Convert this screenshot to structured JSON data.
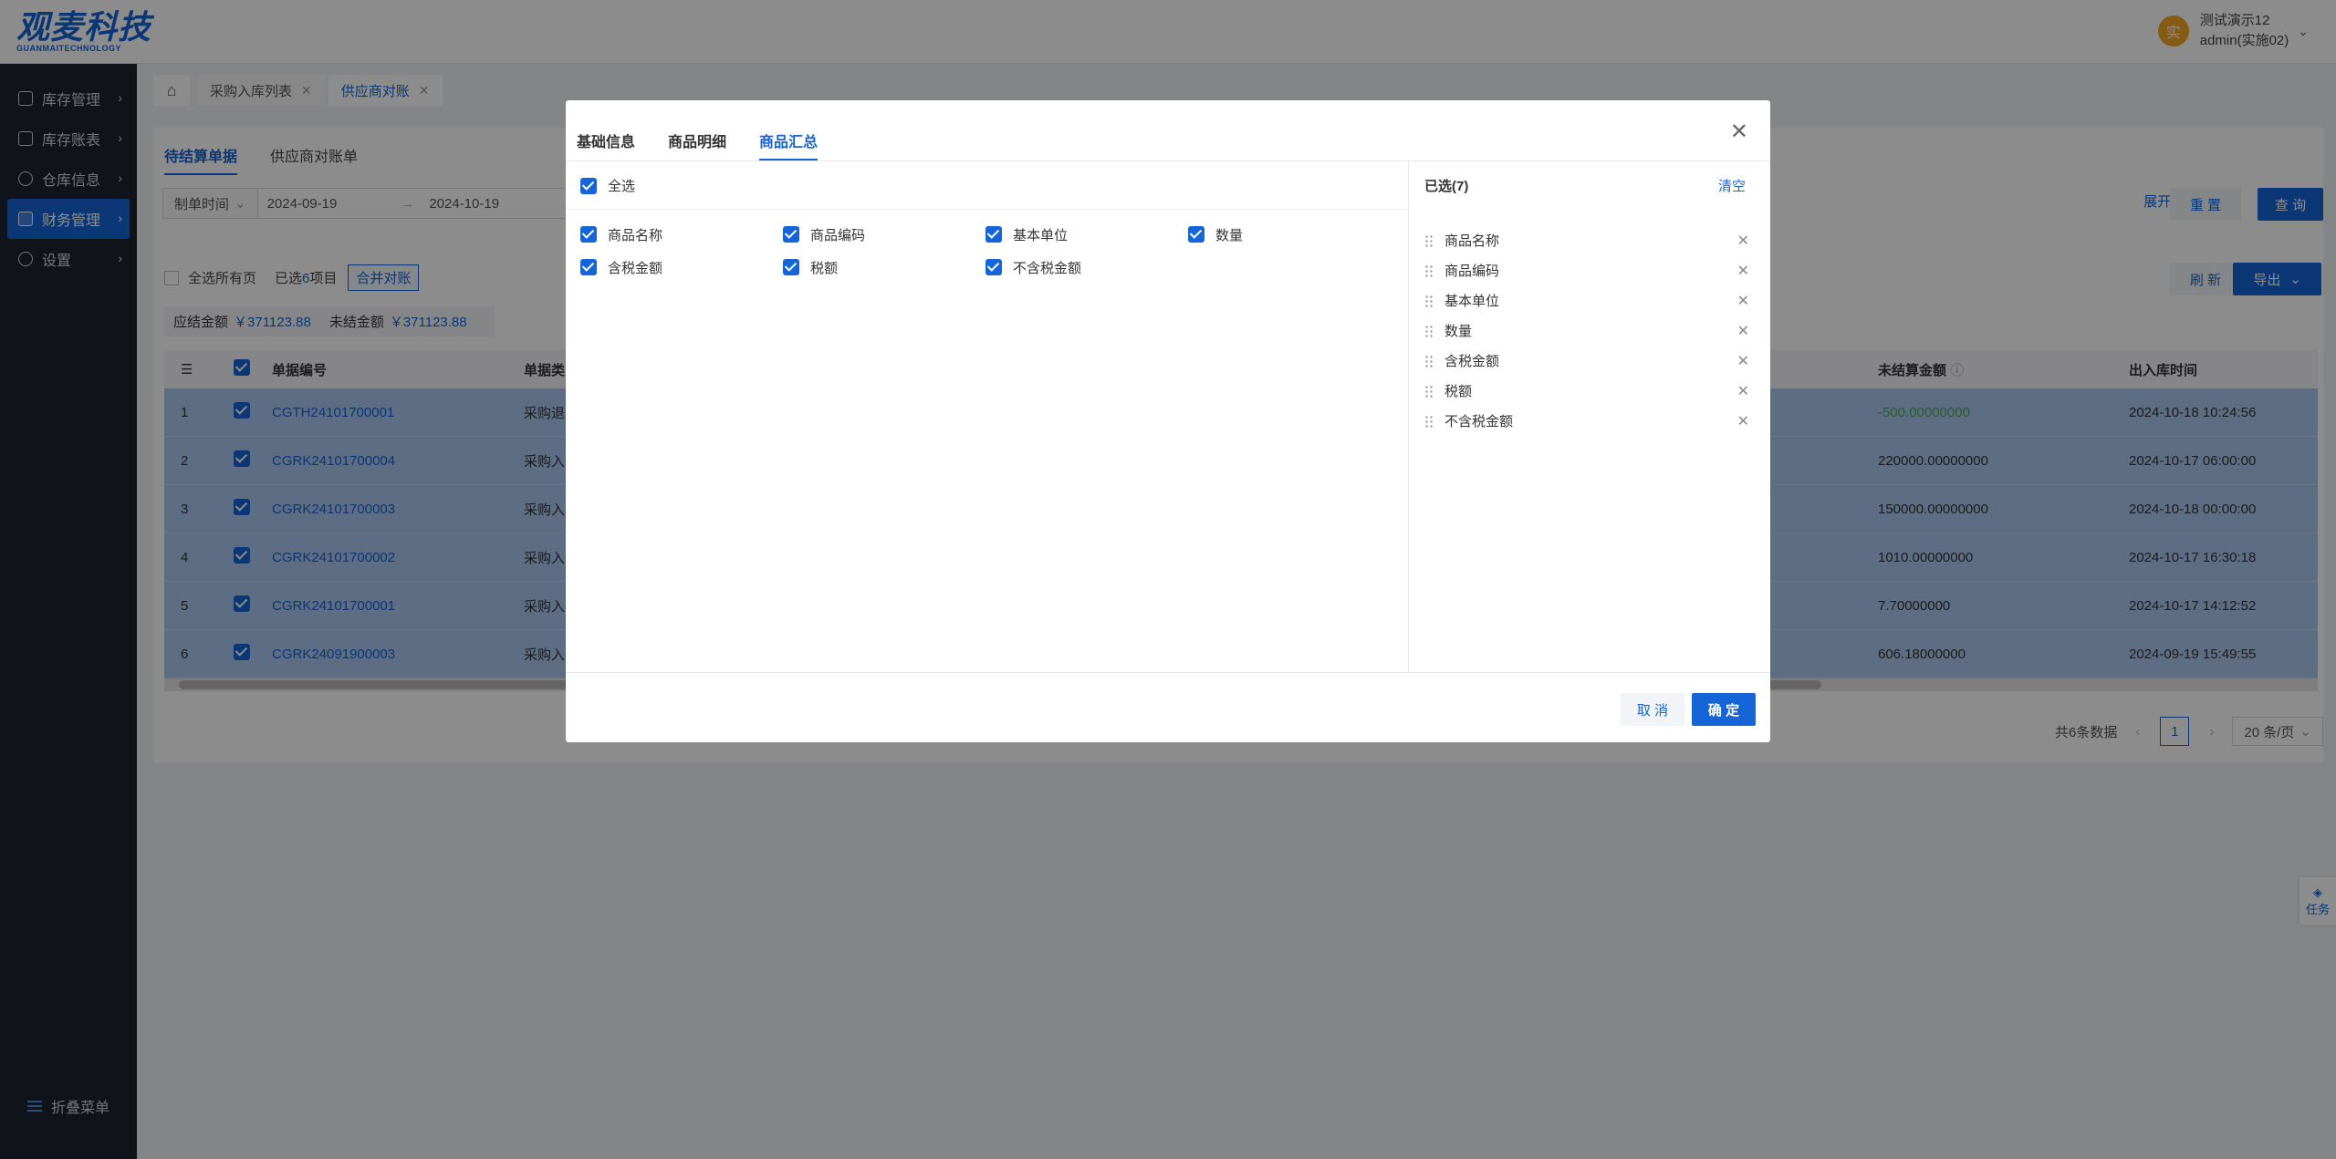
{
  "brand": {
    "name_cn": "观麦科技",
    "name_en": "GUANMAITECHNOLOGY",
    "color": "#1565d8"
  },
  "user": {
    "avatar": "实",
    "name": "测试演示12",
    "account": "admin(实施02)"
  },
  "sidebar": {
    "items": [
      {
        "label": "库存管理",
        "icon": "warehouse-icon"
      },
      {
        "label": "库存账表",
        "icon": "ledger-icon"
      },
      {
        "label": "仓库信息",
        "icon": "location-icon"
      },
      {
        "label": "财务管理",
        "icon": "finance-icon",
        "active": true
      },
      {
        "label": "设置",
        "icon": "gear-icon"
      }
    ],
    "collapse_label": "折叠菜单"
  },
  "page_tabs": [
    {
      "label": "采购入库列表"
    },
    {
      "label": "供应商对账",
      "active": true
    }
  ],
  "subtabs": [
    {
      "label": "待结算单据",
      "active": true
    },
    {
      "label": "供应商对账单"
    }
  ],
  "filter": {
    "field": "制单时间",
    "start": "2024-09-19",
    "end": "2024-10-19",
    "expand_label": "展开",
    "reset_label": "重 置",
    "query_label": "查 询"
  },
  "toolbar": {
    "select_all_pages": "全选所有页",
    "selected_prefix": "已选",
    "selected_count": "6",
    "selected_suffix": "项目",
    "merge_label": "合并对账",
    "refresh_label": "刷 新",
    "export_label": "导出"
  },
  "amounts": {
    "payable_label": "应结金额",
    "payable_value": "￥371123.88",
    "unsettled_label": "未结金额",
    "unsettled_value": "￥371123.88"
  },
  "table": {
    "headers": {
      "doc_no": "单据编号",
      "doc_type": "单据类",
      "unsettled": "未结算金额",
      "time": "出入库时间"
    },
    "rows": [
      {
        "idx": "1",
        "no": "CGTH24101700001",
        "type": "采购退",
        "amount": "-500.00000000",
        "time": "2024-10-18 10:24:56"
      },
      {
        "idx": "2",
        "no": "CGRK24101700004",
        "type": "采购入",
        "amount": "220000.00000000",
        "time": "2024-10-17 06:00:00"
      },
      {
        "idx": "3",
        "no": "CGRK24101700003",
        "type": "采购入",
        "amount": "150000.00000000",
        "time": "2024-10-18 00:00:00"
      },
      {
        "idx": "4",
        "no": "CGRK24101700002",
        "type": "采购入",
        "amount": "1010.00000000",
        "time": "2024-10-17 16:30:18"
      },
      {
        "idx": "5",
        "no": "CGRK24101700001",
        "type": "采购入",
        "amount": "7.70000000",
        "time": "2024-10-17 14:12:52"
      },
      {
        "idx": "6",
        "no": "CGRK24091900003",
        "type": "采购入",
        "amount": "606.18000000",
        "time": "2024-09-19 15:49:55"
      }
    ]
  },
  "pagination": {
    "total": "共6条数据",
    "page": "1",
    "page_size": "20 条/页"
  },
  "task_float": "任务",
  "modal": {
    "tabs": [
      {
        "label": "基础信息"
      },
      {
        "label": "商品明细"
      },
      {
        "label": "商品汇总",
        "active": true
      }
    ],
    "select_all": "全选",
    "options": [
      "商品名称",
      "商品编码",
      "基本单位",
      "数量",
      "含税金额",
      "税额",
      "不含税金额"
    ],
    "selected_title": "已选(7)",
    "clear_label": "清空",
    "selected": [
      "商品名称",
      "商品编码",
      "基本单位",
      "数量",
      "含税金额",
      "税额",
      "不含税金额"
    ],
    "cancel_label": "取 消",
    "ok_label": "确 定"
  }
}
